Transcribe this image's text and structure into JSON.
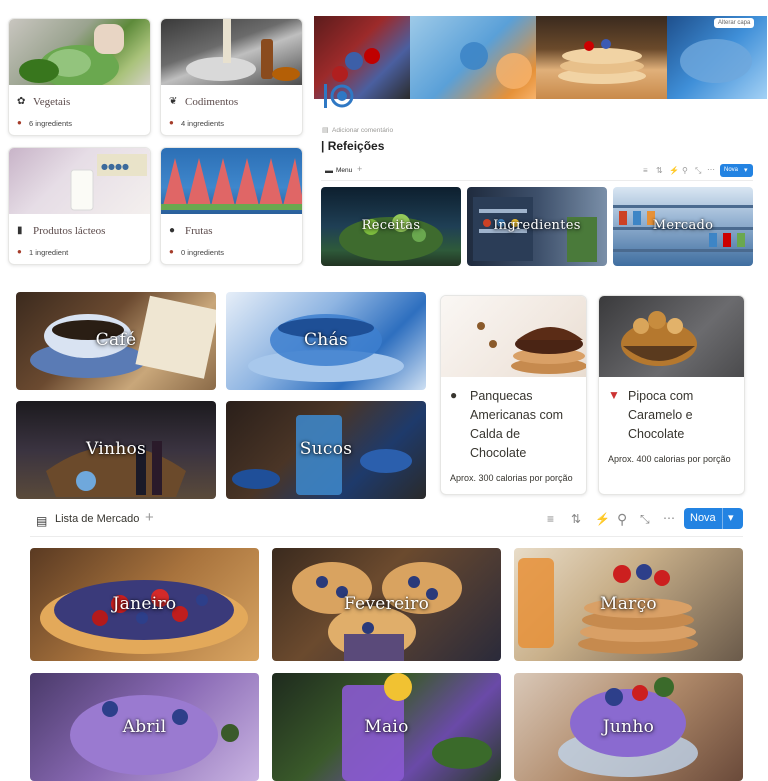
{
  "categories": [
    {
      "name": "Vegetais",
      "icon": "leaf-icon",
      "count": "6 ingredients"
    },
    {
      "name": "Codimentos",
      "icon": "chili-icon",
      "count": "4 ingredients"
    },
    {
      "name": "Produtos lácteos",
      "icon": "milk-icon",
      "count": "1 ingredient"
    },
    {
      "name": "Frutas",
      "icon": "apple-icon",
      "count": "0 ingredients"
    }
  ],
  "cover": {
    "change_label": "Alterar capa"
  },
  "page": {
    "add_comment": "Adicionar comentário",
    "title": "Refeições",
    "view_tab": "Menu",
    "add": "+",
    "new_button": "Nova"
  },
  "gallery_small": [
    "Receitas",
    "Ingredientes",
    "Mercado"
  ],
  "drinks": [
    "Café",
    "Chás",
    "Vinhos",
    "Sucos"
  ],
  "recipes": [
    {
      "emoji": "🥞",
      "title": "Panquecas Americanas com Calda de Chocolate",
      "lines": [
        "Panquecas",
        "Americanas com",
        "Calda de",
        "Chocolate"
      ],
      "calories": "Aprox. 300 calorias por porção"
    },
    {
      "emoji": "🍿",
      "title": "Pipoca com Caramelo e Chocolate",
      "lines": [
        "Pipoca com",
        "Caramelo e",
        "Chocolate"
      ],
      "calories": "Aprox. 400 calorias por porção"
    }
  ],
  "shopping": {
    "title": "Lista de Mercado",
    "add": "+",
    "new_button": "Nova",
    "months": [
      "Janeiro",
      "Fevereiro",
      "Março",
      "Abril",
      "Maio",
      "Junho"
    ]
  },
  "colors": {
    "accent": "#2383e2",
    "card_border": "#e6e6e4"
  }
}
